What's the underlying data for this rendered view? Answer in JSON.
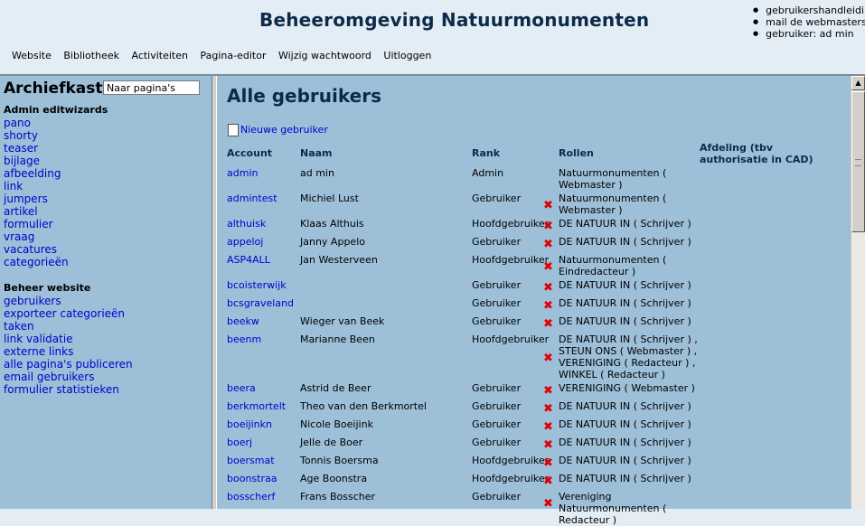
{
  "header": {
    "title": "Beheeromgeving Natuurmonumenten",
    "nav": [
      "Website",
      "Bibliotheek",
      "Activiteiten",
      "Pagina-editor",
      "Wijzig wachtwoord",
      "Uitloggen"
    ],
    "toplinks": [
      "gebruikershandleiding",
      "mail de webmasters",
      "gebruiker: ad min"
    ]
  },
  "sidebar": {
    "title": "Archiefkast",
    "search_value": "Naar pagina's",
    "section1_title": "Admin editwizards",
    "section1_items": [
      "pano",
      "shorty",
      "teaser",
      "bijlage",
      "afbeelding",
      "link",
      "jumpers",
      "artikel",
      "formulier",
      "vraag",
      "vacatures",
      "categorieën"
    ],
    "section2_title": "Beheer website",
    "section2_items": [
      "gebruikers",
      "exporteer categorieën",
      "taken",
      "link validatie",
      "externe links",
      "alle pagina's publiceren",
      "email gebruikers",
      "formulier statistieken"
    ]
  },
  "main": {
    "title": "Alle gebruikers",
    "new_user_label": "Nieuwe gebruiker",
    "headers": {
      "account": "Account",
      "naam": "Naam",
      "rank": "Rank",
      "rollen": "Rollen",
      "afdeling": "Afdeling (tbv authorisatie in CAD)"
    },
    "rows": [
      {
        "account": "admin",
        "naam": "ad min",
        "rank": "Admin",
        "del": false,
        "rollen": "Natuurmonumenten ( Webmaster )"
      },
      {
        "account": "admintest",
        "naam": "Michiel Lust",
        "rank": "Gebruiker",
        "del": true,
        "rollen": "Natuurmonumenten ( Webmaster )"
      },
      {
        "account": "althuisk",
        "naam": "Klaas Althuis",
        "rank": "Hoofdgebruiker",
        "del": true,
        "rollen": "DE NATUUR IN ( Schrijver )"
      },
      {
        "account": "appeloj",
        "naam": "Janny Appelo",
        "rank": "Gebruiker",
        "del": true,
        "rollen": "DE NATUUR IN ( Schrijver )"
      },
      {
        "account": "ASP4ALL",
        "naam": "Jan Westerveen",
        "rank": "Hoofdgebruiker",
        "del": true,
        "rollen": "Natuurmonumenten ( Eindredacteur )"
      },
      {
        "account": "bcoisterwijk",
        "naam": "",
        "rank": "Gebruiker",
        "del": true,
        "rollen": "DE NATUUR IN ( Schrijver )"
      },
      {
        "account": "bcsgraveland",
        "naam": "",
        "rank": "Gebruiker",
        "del": true,
        "rollen": "DE NATUUR IN ( Schrijver )"
      },
      {
        "account": "beekw",
        "naam": "Wieger van Beek",
        "rank": "Gebruiker",
        "del": true,
        "rollen": "DE NATUUR IN ( Schrijver )"
      },
      {
        "account": "beenm",
        "naam": "Marianne Been",
        "rank": "Hoofdgebruiker",
        "del": true,
        "rollen": "DE NATUUR IN ( Schrijver ) , STEUN ONS ( Webmaster ) , VERENIGING ( Redacteur ) , WINKEL ( Redacteur )"
      },
      {
        "account": "beera",
        "naam": "Astrid de Beer",
        "rank": "Gebruiker",
        "del": true,
        "rollen": "VERENIGING ( Webmaster )"
      },
      {
        "account": "berkmortelt",
        "naam": "Theo van den Berkmortel",
        "rank": "Gebruiker",
        "del": true,
        "rollen": "DE NATUUR IN ( Schrijver )"
      },
      {
        "account": "boeijinkn",
        "naam": "Nicole Boeijink",
        "rank": "Gebruiker",
        "del": true,
        "rollen": "DE NATUUR IN ( Schrijver )"
      },
      {
        "account": "boerj",
        "naam": "Jelle de Boer",
        "rank": "Gebruiker",
        "del": true,
        "rollen": "DE NATUUR IN ( Schrijver )"
      },
      {
        "account": "boersmat",
        "naam": "Tonnis Boersma",
        "rank": "Hoofdgebruiker",
        "del": true,
        "rollen": "DE NATUUR IN ( Schrijver )"
      },
      {
        "account": "boonstraa",
        "naam": "Age Boonstra",
        "rank": "Hoofdgebruiker",
        "del": true,
        "rollen": "DE NATUUR IN ( Schrijver )"
      },
      {
        "account": "bosscherf",
        "naam": "Frans Bosscher",
        "rank": "Gebruiker",
        "del": true,
        "rollen": "Vereniging Natuurmonumenten ( Redacteur )"
      }
    ]
  }
}
